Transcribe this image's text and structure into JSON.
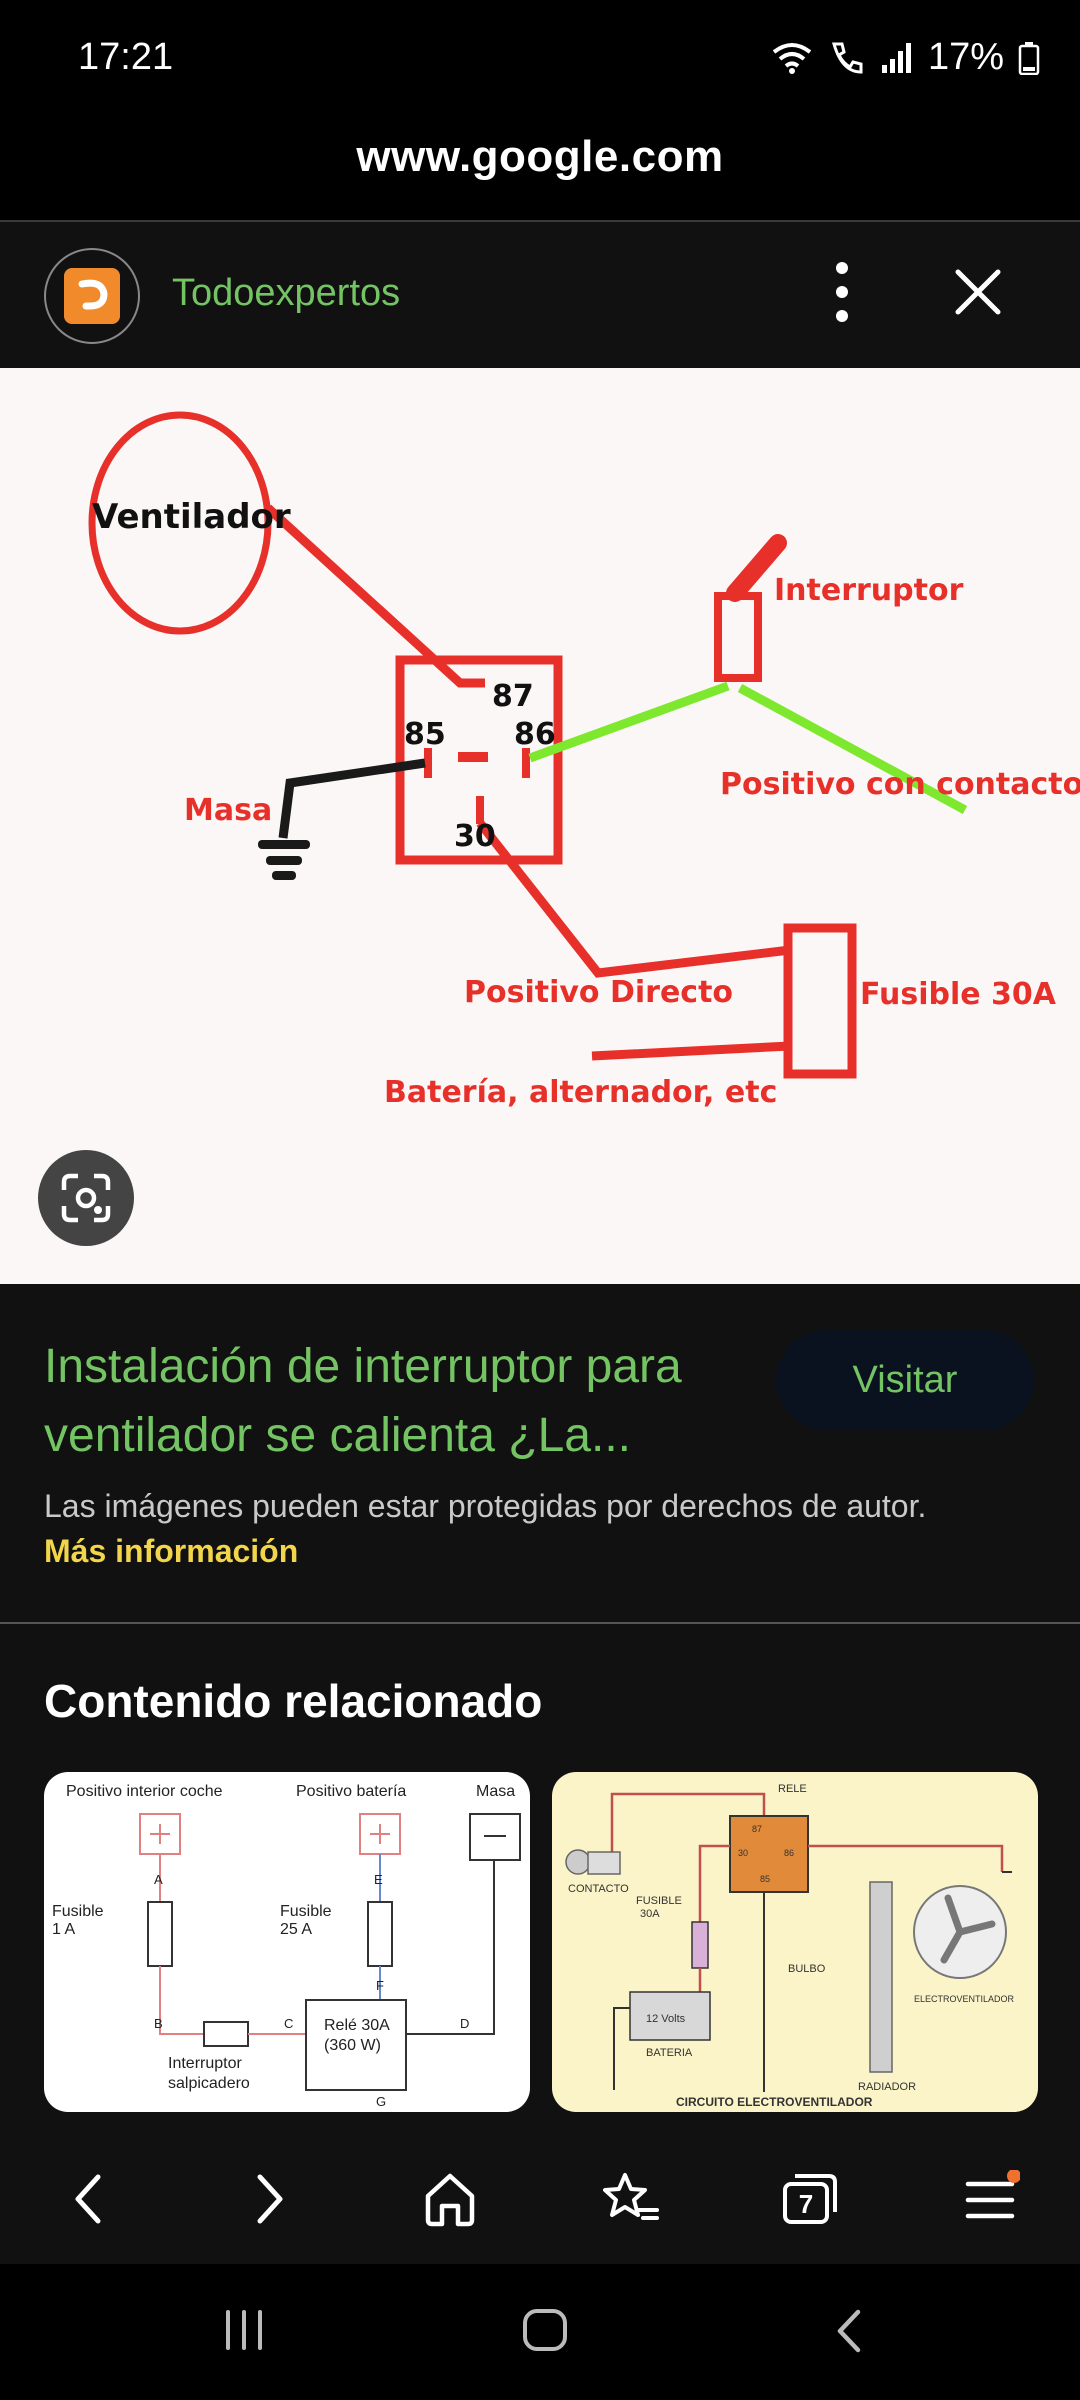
{
  "status_bar": {
    "time": "17:21",
    "battery": "17%"
  },
  "browser": {
    "url": "www.google.com"
  },
  "source": {
    "name": "Todoexpertos"
  },
  "diagram": {
    "ventilador": "Ventilador",
    "interruptor": "Interruptor",
    "pin_87": "87",
    "pin_85": "85",
    "pin_86": "86",
    "pin_30": "30",
    "masa": "Masa",
    "positivo_contacto": "Positivo con contacto",
    "positivo_directo": "Positivo Directo",
    "fusible": "Fusible 30A",
    "bateria": "Batería, alternador, etc"
  },
  "result": {
    "title": "Instalación de interruptor para ventilador se calienta ¿La...",
    "visit_label": "Visitar",
    "copyright_note": "Las imágenes pueden estar protegidas por derechos de autor.",
    "more_info": "Más información"
  },
  "related": {
    "heading": "Contenido relacionado",
    "card1": {
      "label_interior": "Positivo interior coche",
      "label_bateria": "Positivo batería",
      "label_masa": "Masa",
      "fusible1": "Fusible",
      "fusible1_val": "1 A",
      "fusible2": "Fusible",
      "fusible2_val": "25 A",
      "rele": "Relé 30A",
      "rele_w": "(360 W)",
      "interruptor": "Interruptor",
      "salpicadero": "salpicadero",
      "pin_a": "A",
      "pin_b": "B",
      "pin_c": "C",
      "pin_d": "D",
      "pin_e": "E",
      "pin_f": "F",
      "pin_g": "G"
    },
    "card2": {
      "rele": "RELE",
      "contacto": "CONTACTO",
      "fusible": "FUSIBLE",
      "fusible_val": "30A",
      "bulbo": "BULBO",
      "volts": "12 Volts",
      "bateria": "BATERIA",
      "radiador": "RADIADOR",
      "electroventilador": "ELECTROVENTILADOR",
      "caption": "CIRCUITO ELECTROVENTILADOR",
      "pin_87": "87",
      "pin_30": "30",
      "pin_85": "85",
      "pin_86": "86"
    }
  },
  "nav": {
    "tab_count": "7"
  },
  "colors": {
    "accent_green": "#74c464",
    "link_yellow": "#f2d54a",
    "diagram_red": "#e8302a",
    "wire_green": "#7ee82f"
  }
}
